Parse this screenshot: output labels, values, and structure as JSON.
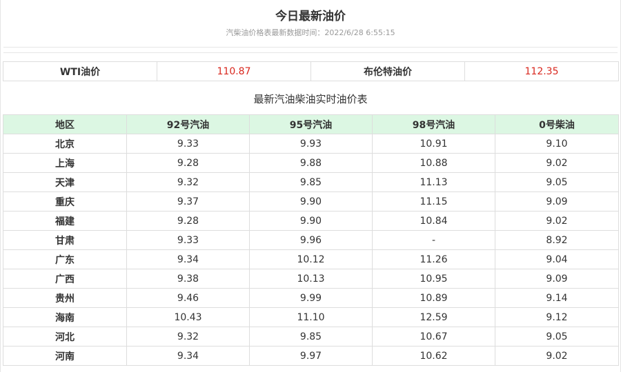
{
  "header": {
    "title": "今日最新油价",
    "subtitle": "汽柴油价格表最新数据时间：2022/6/28 6:55:15"
  },
  "crude": {
    "wti_label": "WTI油价",
    "wti_value": "110.87",
    "brent_label": "布伦特油价",
    "brent_value": "112.35"
  },
  "table": {
    "caption": "最新汽油柴油实时油价表",
    "headers": [
      "地区",
      "92号汽油",
      "95号汽油",
      "98号汽油",
      "0号柴油"
    ],
    "rows": [
      [
        "北京",
        "9.33",
        "9.93",
        "10.91",
        "9.10"
      ],
      [
        "上海",
        "9.28",
        "9.88",
        "10.88",
        "9.02"
      ],
      [
        "天津",
        "9.32",
        "9.85",
        "11.13",
        "9.05"
      ],
      [
        "重庆",
        "9.37",
        "9.90",
        "11.15",
        "9.09"
      ],
      [
        "福建",
        "9.28",
        "9.90",
        "10.84",
        "9.02"
      ],
      [
        "甘肃",
        "9.33",
        "9.96",
        "-",
        "8.92"
      ],
      [
        "广东",
        "9.34",
        "10.12",
        "11.26",
        "9.04"
      ],
      [
        "广西",
        "9.38",
        "10.13",
        "10.95",
        "9.09"
      ],
      [
        "贵州",
        "9.46",
        "9.99",
        "10.89",
        "9.14"
      ],
      [
        "海南",
        "10.43",
        "11.10",
        "12.59",
        "9.12"
      ],
      [
        "河北",
        "9.32",
        "9.85",
        "10.67",
        "9.05"
      ],
      [
        "河南",
        "9.34",
        "9.97",
        "10.62",
        "9.02"
      ]
    ]
  },
  "colors": {
    "price_red": "#d9271e",
    "header_green": "#dcf7e3"
  }
}
